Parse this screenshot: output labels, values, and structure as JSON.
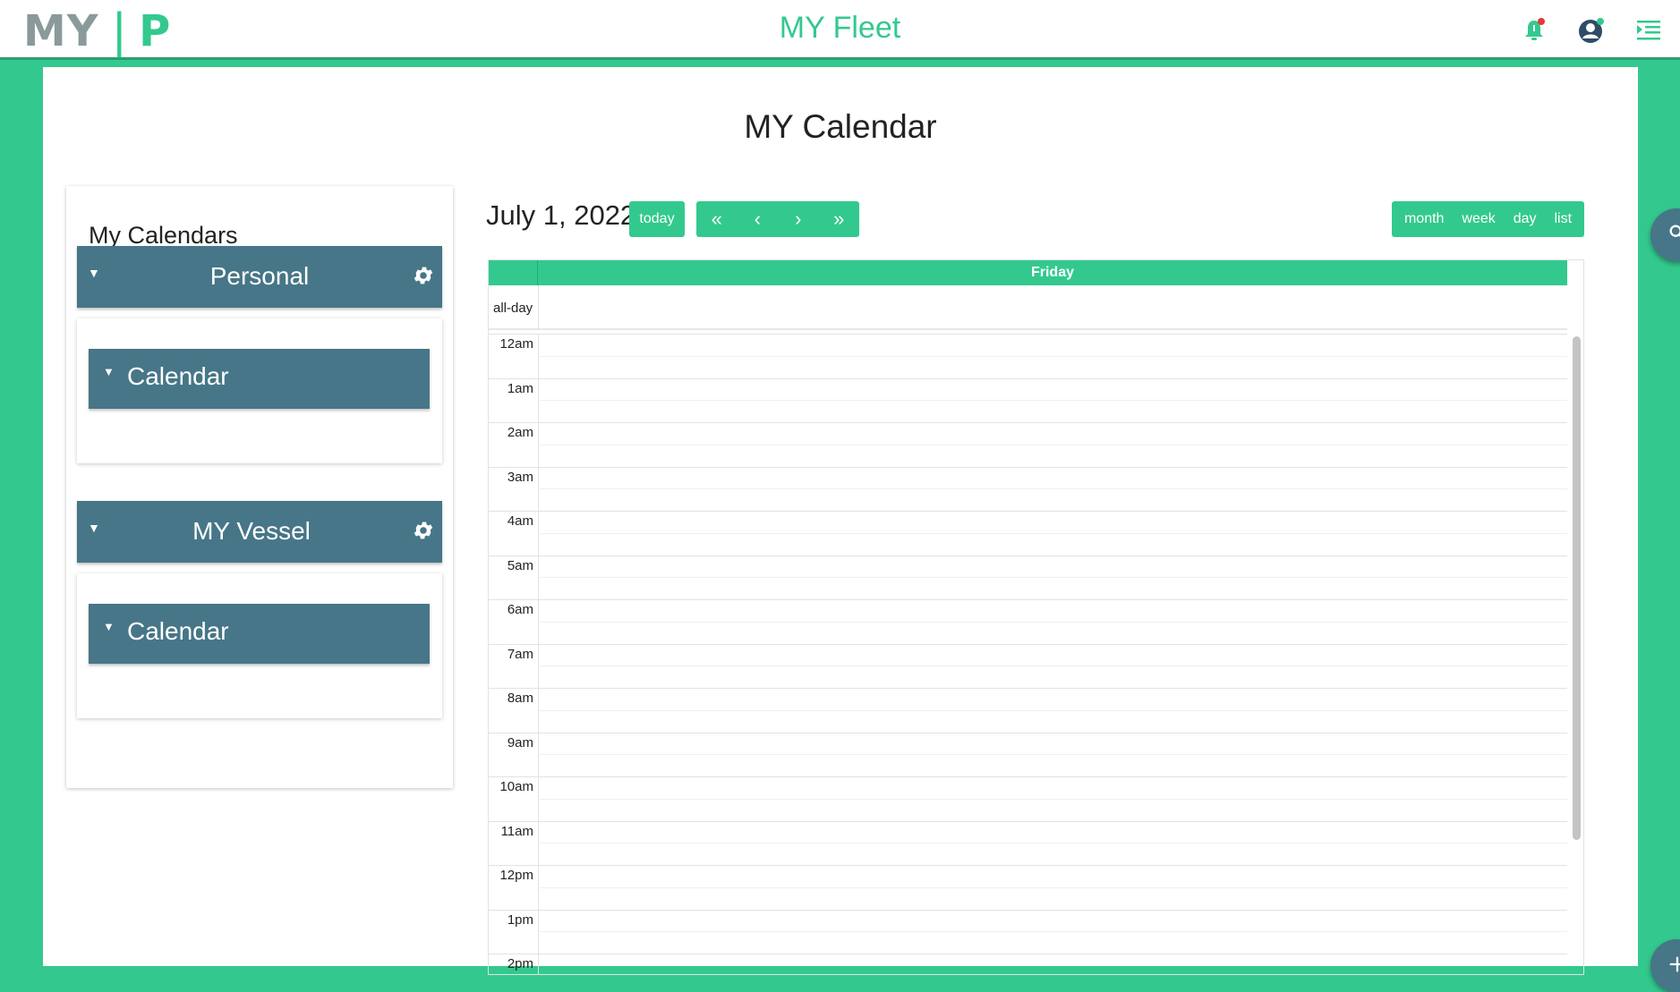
{
  "header": {
    "logo_left": "MY",
    "logo_sep": "|",
    "logo_right": "P",
    "app_title": "MY Fleet"
  },
  "page": {
    "title": "MY Calendar"
  },
  "sidebar": {
    "title": "My Calendars",
    "groups": [
      {
        "name": "Personal",
        "calendar": "Calendar"
      },
      {
        "name": "MY Vessel",
        "calendar": "Calendar"
      }
    ]
  },
  "calendar": {
    "date": "July 1, 2022",
    "today_label": "today",
    "nav": {
      "prev_year": "«",
      "prev": "‹",
      "next": "›",
      "next_year": "»"
    },
    "views": [
      "month",
      "week",
      "day",
      "list"
    ],
    "day_header": "Friday",
    "allday_label": "all-day",
    "hours": [
      "12am",
      "1am",
      "2am",
      "3am",
      "4am",
      "5am",
      "6am",
      "7am",
      "8am",
      "9am",
      "10am",
      "11am",
      "12pm",
      "1pm",
      "2pm"
    ]
  },
  "colors": {
    "accent": "#33c98e",
    "panel": "#467687",
    "logo_grey": "#8a9a9a"
  },
  "icons": {
    "bell": "bell-icon",
    "user": "user-account-icon",
    "menu": "menu-indent-icon",
    "gear": "gear-icon",
    "search": "search-icon",
    "add": "plus-icon",
    "caret": "caret-down-icon"
  }
}
